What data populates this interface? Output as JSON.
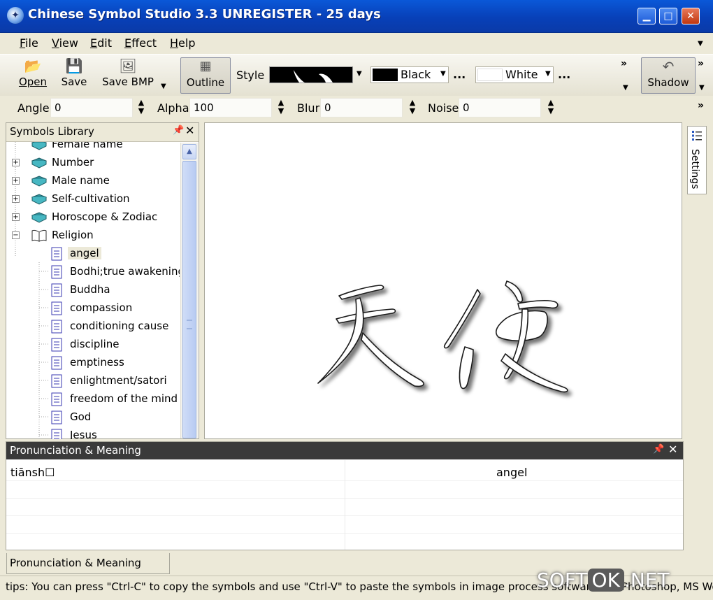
{
  "window": {
    "title": "Chinese Symbol Studio 3.3 UNREGISTER - 25 days"
  },
  "menu": {
    "items": [
      {
        "label": "File",
        "u": "F",
        "rest": "ile"
      },
      {
        "label": "View",
        "u": "V",
        "rest": "iew"
      },
      {
        "label": "Edit",
        "u": "E",
        "rest": "dit"
      },
      {
        "label": "Effect",
        "u": "E",
        "rest": "ffect"
      },
      {
        "label": "Help",
        "u": "H",
        "rest": "elp"
      }
    ]
  },
  "toolbar": {
    "open_label": "Open",
    "save_label": "Save",
    "savebmp_label": "Save BMP",
    "outline_label": "Outline",
    "style_label": "Style",
    "color1_label": "Black",
    "color1_value": "#000000",
    "color2_label": "White",
    "color2_value": "#ffffff",
    "more_label": "...",
    "shadow_label": "Shadow"
  },
  "params": {
    "angle_label": "Angle",
    "angle_value": "0",
    "alpha_label": "Alpha",
    "alpha_value": "100",
    "blur_label": "Blur",
    "blur_value": "0",
    "noise_label": "Noise",
    "noise_value": "0"
  },
  "library": {
    "title": "Symbols Library",
    "partial_top": "Female name",
    "categories": [
      "Number",
      "Male name",
      "Self-cultivation",
      "Horoscope & Zodiac",
      "Religion"
    ],
    "items": [
      "angel",
      "Bodhi;true awakening",
      "Buddha",
      "compassion",
      "conditioning cause",
      "discipline",
      "emptiness",
      "enlightment/satori",
      "freedom of the mind",
      "God",
      "Jesus"
    ],
    "selected": "angel"
  },
  "canvas": {
    "symbol": "天使"
  },
  "settings_tab": {
    "label": "Settings"
  },
  "pronunciation": {
    "title": "Pronunciation & Meaning",
    "pinyin": "tiānsh☐",
    "meaning": "angel",
    "tab_label": "Pronunciation & Meaning"
  },
  "status": {
    "tips": "tips: You can press \"Ctrl-C\" to copy the symbols and use \"Ctrl-V\" to paste the symbols in image process software like Photoshop, MS Word..."
  },
  "watermark": {
    "left": "SOFT",
    "mid": "OK",
    "right": ".NET"
  },
  "icons": [
    "app-icon",
    "open-icon",
    "save-icon",
    "savebmp-icon",
    "outline-icon",
    "shadow-icon",
    "book-icon",
    "book-open-icon",
    "doc-icon",
    "pin-icon",
    "close-icon",
    "settings-icon",
    "chevron-icon",
    "dropdown-icon",
    "spin-icon"
  ]
}
